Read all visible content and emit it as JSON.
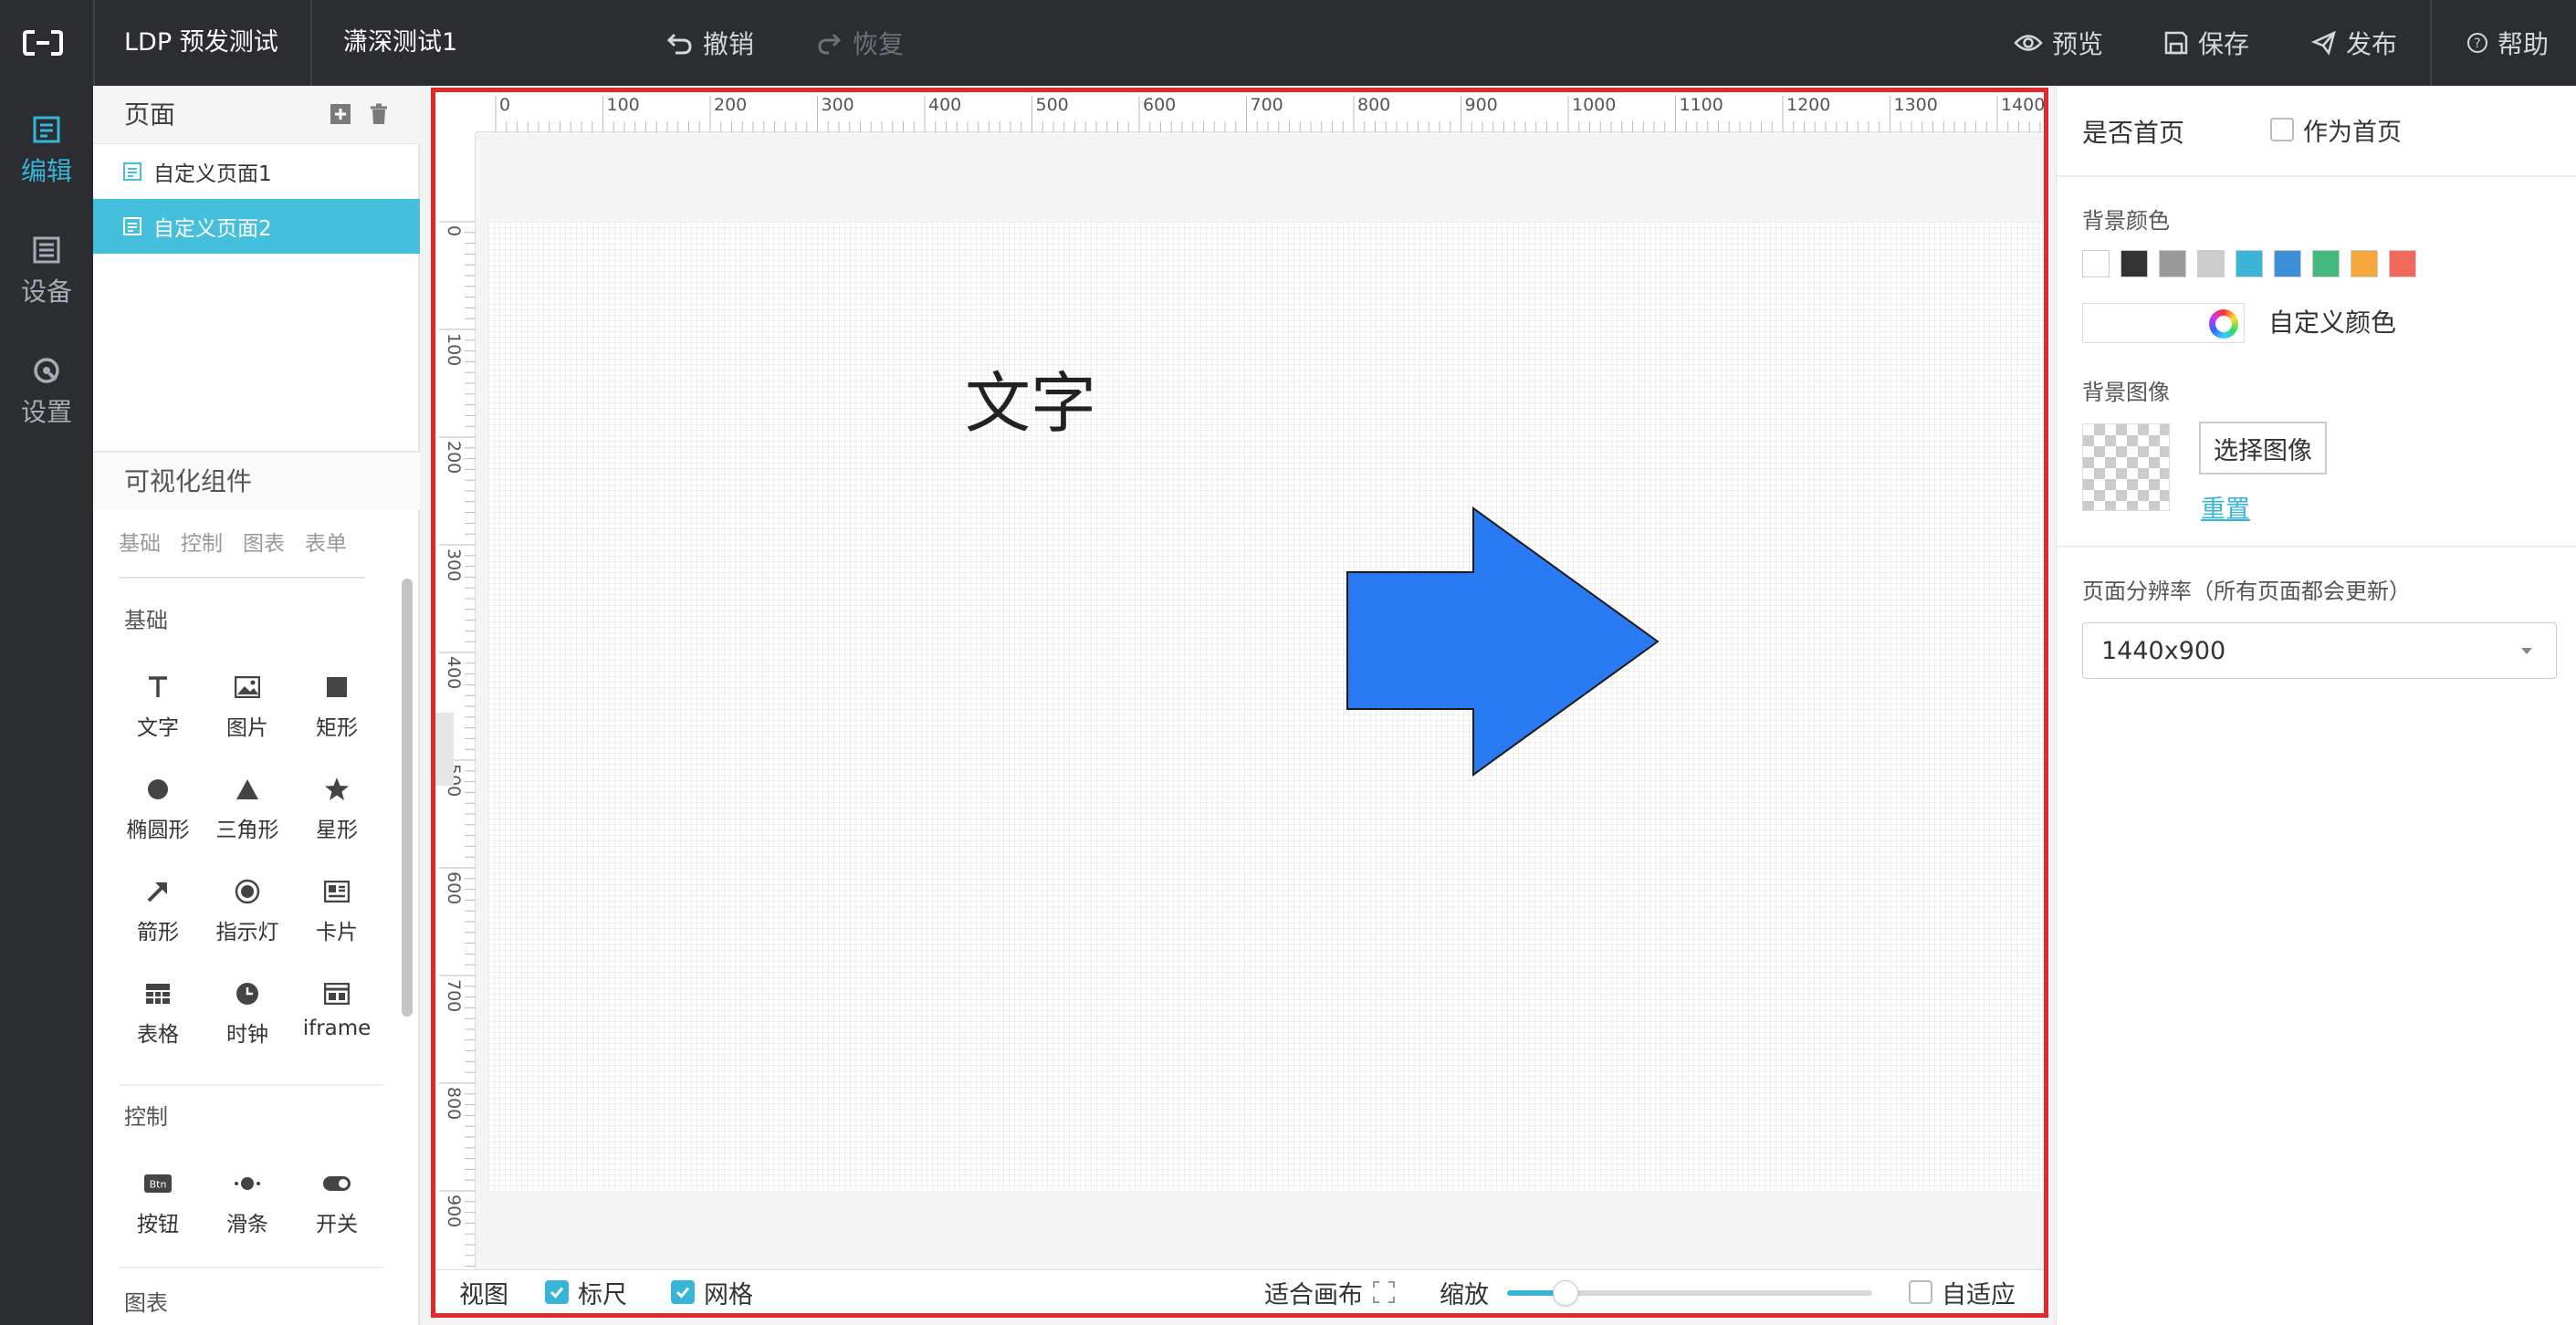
{
  "topbar": {
    "app_title": "LDP 预发测试",
    "project_name": "潇深测试1",
    "undo_label": "撤销",
    "redo_label": "恢复",
    "preview_label": "预览",
    "save_label": "保存",
    "publish_label": "发布",
    "help_label": "帮助"
  },
  "leftnav": {
    "items": [
      {
        "label": "编辑",
        "icon": "edit-icon",
        "active": true
      },
      {
        "label": "设备",
        "icon": "device-icon",
        "active": false
      },
      {
        "label": "设置",
        "icon": "settings-icon",
        "active": false
      }
    ]
  },
  "pages": {
    "title": "页面",
    "items": [
      {
        "label": "自定义页面1",
        "selected": false
      },
      {
        "label": "自定义页面2",
        "selected": true
      }
    ]
  },
  "components": {
    "title": "可视化组件",
    "tabs": [
      "基础",
      "控制",
      "图表",
      "表单"
    ],
    "sections": {
      "basic": {
        "title": "基础",
        "items": [
          {
            "label": "文字",
            "icon": "text-icon"
          },
          {
            "label": "图片",
            "icon": "image-icon"
          },
          {
            "label": "矩形",
            "icon": "rectangle-icon"
          },
          {
            "label": "椭圆形",
            "icon": "ellipse-icon"
          },
          {
            "label": "三角形",
            "icon": "triangle-icon"
          },
          {
            "label": "星形",
            "icon": "star-icon"
          },
          {
            "label": "箭形",
            "icon": "arrow-icon"
          },
          {
            "label": "指示灯",
            "icon": "indicator-icon"
          },
          {
            "label": "卡片",
            "icon": "card-icon"
          },
          {
            "label": "表格",
            "icon": "table-icon"
          },
          {
            "label": "时钟",
            "icon": "clock-icon"
          },
          {
            "label": "iframe",
            "icon": "iframe-icon"
          }
        ]
      },
      "control": {
        "title": "控制",
        "items": [
          {
            "label": "按钮",
            "icon": "button-icon",
            "glyph": "Btn"
          },
          {
            "label": "滑条",
            "icon": "slider-icon"
          },
          {
            "label": "开关",
            "icon": "switch-icon"
          }
        ]
      },
      "chart": {
        "title": "图表"
      }
    }
  },
  "canvas": {
    "ruler_x": [
      "0",
      "100",
      "200",
      "300",
      "400",
      "500",
      "600",
      "700",
      "800",
      "900",
      "1000",
      "1100",
      "1200",
      "1300",
      "1400"
    ],
    "ruler_y": [
      "0",
      "100",
      "200",
      "300",
      "400",
      "500",
      "600",
      "700",
      "800",
      "900"
    ],
    "text_element": "文字",
    "arrow_color": "#2979f2",
    "accent_color": "#37b5d9",
    "selection_color": "#e02a2a"
  },
  "canvas_bar": {
    "view_label": "视图",
    "ruler_label": "标尺",
    "ruler_checked": true,
    "grid_label": "网格",
    "grid_checked": true,
    "fit_label": "适合画布",
    "zoom_label": "缩放",
    "zoom_fraction": 0.16,
    "adaptive_label": "自适应",
    "adaptive_checked": false
  },
  "properties": {
    "homepage_label": "是否首页",
    "homepage_checkbox_label": "作为首页",
    "homepage_checked": false,
    "bg_color_label": "背景颜色",
    "bg_colors": [
      "#ffffff",
      "#333333",
      "#999999",
      "#cccccc",
      "#3bb4d8",
      "#3d8fd8",
      "#43b97e",
      "#f5a73b",
      "#f0695a"
    ],
    "custom_color_label": "自定义颜色",
    "bg_image_label": "背景图像",
    "choose_image_label": "选择图像",
    "reset_label": "重置",
    "resolution_label": "页面分辨率（所有页面都会更新）",
    "resolution_value": "1440x900"
  }
}
